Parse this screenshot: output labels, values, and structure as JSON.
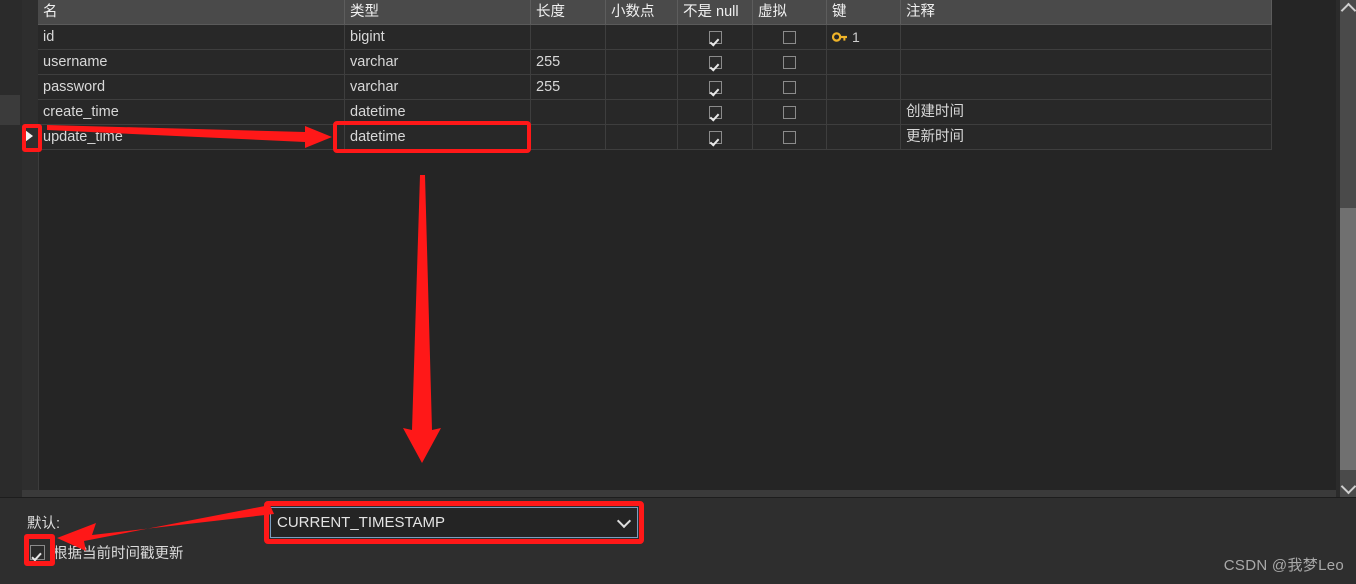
{
  "grid": {
    "columns": [
      {
        "key": "name",
        "label": "名"
      },
      {
        "key": "type",
        "label": "类型"
      },
      {
        "key": "length",
        "label": "长度"
      },
      {
        "key": "decimal",
        "label": "小数点"
      },
      {
        "key": "notnull",
        "label": "不是 null"
      },
      {
        "key": "virtual",
        "label": "虚拟"
      },
      {
        "key": "key",
        "label": "键"
      },
      {
        "key": "comment",
        "label": "注释"
      }
    ],
    "rows": [
      {
        "name": "id",
        "type": "bigint",
        "length": "",
        "decimal": "",
        "notnull": true,
        "virtual": false,
        "key": "1",
        "comment": ""
      },
      {
        "name": "username",
        "type": "varchar",
        "length": "255",
        "decimal": "",
        "notnull": true,
        "virtual": false,
        "key": "",
        "comment": ""
      },
      {
        "name": "password",
        "type": "varchar",
        "length": "255",
        "decimal": "",
        "notnull": true,
        "virtual": false,
        "key": "",
        "comment": ""
      },
      {
        "name": "create_time",
        "type": "datetime",
        "length": "",
        "decimal": "",
        "notnull": true,
        "virtual": false,
        "key": "",
        "comment": "创建时间"
      },
      {
        "name": "update_time",
        "type": "datetime",
        "length": "",
        "decimal": "",
        "notnull": true,
        "virtual": false,
        "key": "",
        "comment": "更新时间"
      }
    ],
    "selected_row_index": 4,
    "key_icon": "key-icon"
  },
  "properties": {
    "default_label": "默认:",
    "default_value": "CURRENT_TIMESTAMP",
    "default_options": [
      "CURRENT_TIMESTAMP"
    ],
    "on_update_label": "根据当前时间戳更新",
    "on_update_checked": true
  },
  "scrollbar": {
    "up_icon": "chevron-up-icon",
    "down_icon": "chevron-down-icon"
  },
  "annotations": {
    "color": "#ff1818",
    "highlight_type_cell": "datetime",
    "highlight_default_value": "CURRENT_TIMESTAMP",
    "highlight_on_update_checkbox": "根据当前时间戳更新"
  },
  "watermark": "CSDN @我梦Leo"
}
